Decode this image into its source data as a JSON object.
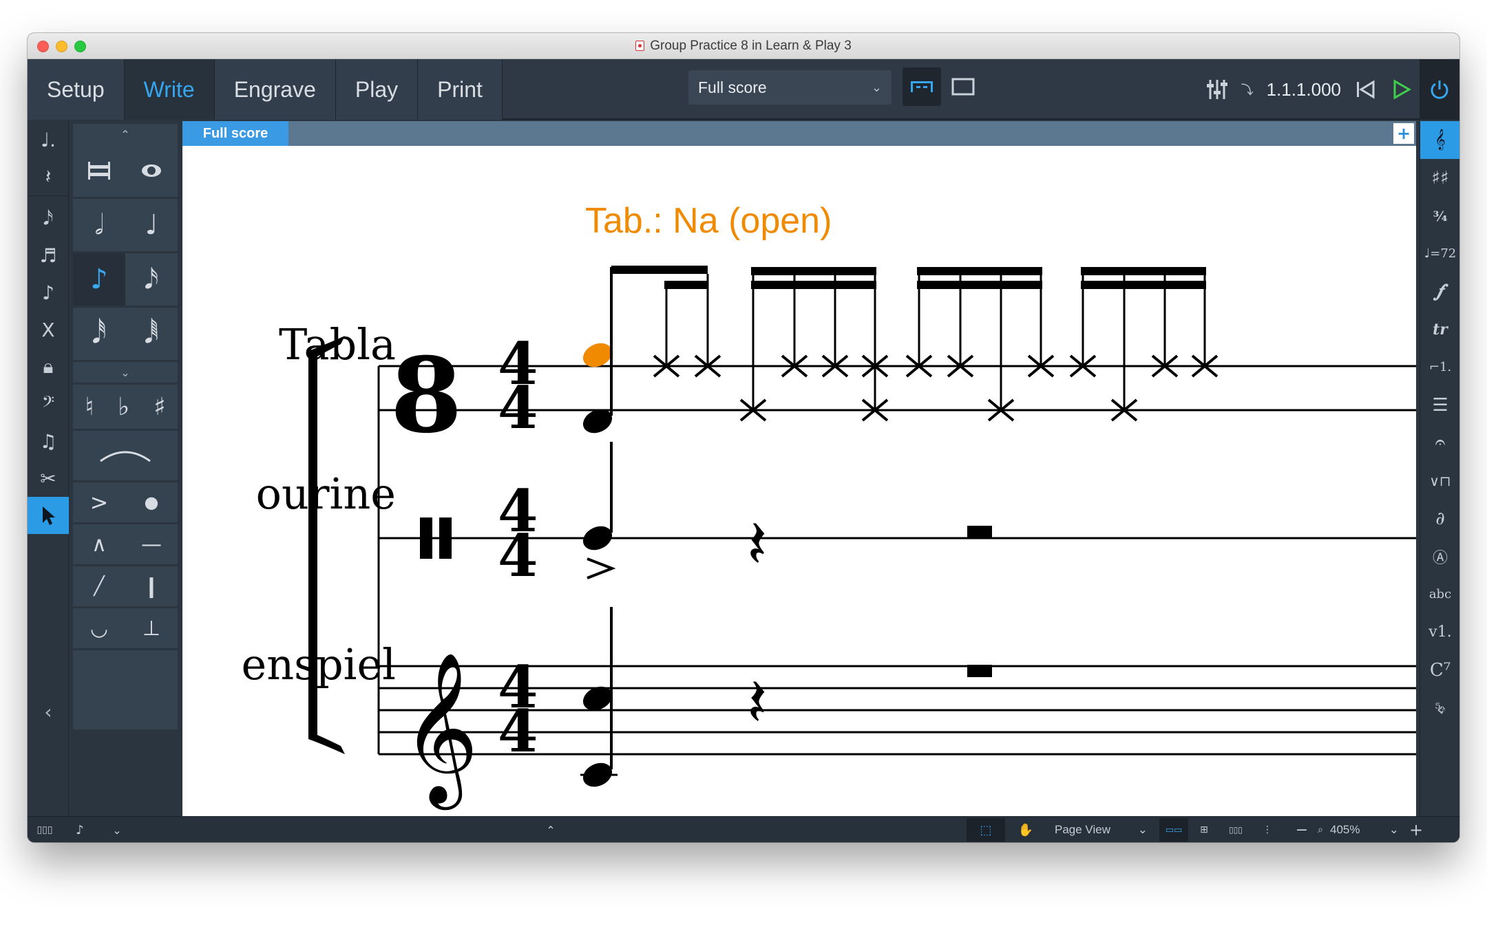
{
  "window": {
    "title": "Group Practice 8 in Learn & Play 3"
  },
  "modes": [
    {
      "label": "Setup"
    },
    {
      "label": "Write"
    },
    {
      "label": "Engrave"
    },
    {
      "label": "Play"
    },
    {
      "label": "Print"
    }
  ],
  "active_mode": "Write",
  "toolbar": {
    "layout_select": "Full score",
    "position": "1.1.1.000"
  },
  "score_tab": {
    "label": "Full score",
    "add_symbol": "+"
  },
  "score": {
    "annotation": "Tab.: Na (open)",
    "instruments": [
      {
        "name": "Tabla"
      },
      {
        "name": "ourine"
      },
      {
        "name": "enspiel"
      }
    ],
    "time_signature": {
      "numerator": "4",
      "denominator": "4"
    },
    "accent_color": "#f08a00"
  },
  "statusbar": {
    "view_type": "Page View",
    "zoom": "405%"
  },
  "colors": {
    "accent_blue": "#36a6ee",
    "toolbar_bg": "#2e3945",
    "tab_bar_bg": "#5c7891"
  }
}
